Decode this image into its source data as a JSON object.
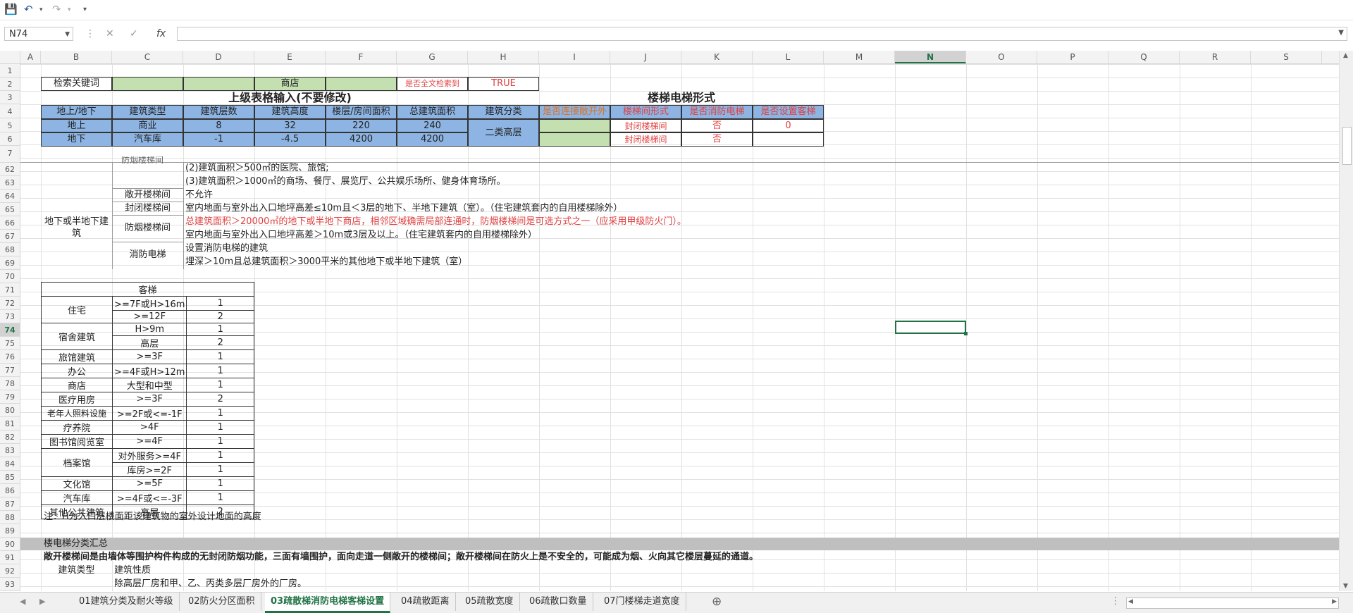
{
  "formula_bar": {
    "name_box": "N74",
    "fx_label": "fx",
    "formula": ""
  },
  "columns": [
    "A",
    "B",
    "C",
    "D",
    "E",
    "F",
    "G",
    "H",
    "I",
    "J",
    "K",
    "L",
    "M",
    "N",
    "O",
    "P",
    "Q",
    "R",
    "S"
  ],
  "selected_column": "N",
  "rows": [
    "1",
    "2",
    "3",
    "4",
    "5",
    "6",
    "7",
    "62",
    "63",
    "64",
    "65",
    "66",
    "67",
    "68",
    "69",
    "70",
    "71",
    "72",
    "73",
    "74",
    "75",
    "76",
    "77",
    "78",
    "79",
    "80",
    "81",
    "82",
    "83",
    "84",
    "85",
    "86",
    "87",
    "88",
    "89",
    "90",
    "91",
    "92",
    "93"
  ],
  "top": {
    "search_label": "检索关键词",
    "search_value": "商店",
    "fulltext_label": "是否全文检索到",
    "fulltext_value": "TRUE",
    "section_left": "上级表格输入(不要修改)",
    "section_right": "楼梯电梯形式",
    "headers": [
      "地上/地下",
      "建筑类型",
      "建筑层数",
      "建筑高度",
      "楼层/房间面积",
      "总建筑面积",
      "建筑分类",
      "是否连接敞开外",
      "楼梯间形式",
      "是否消防电梯",
      "是否设置客梯"
    ],
    "row_above": [
      "地上",
      "商业",
      "8",
      "32",
      "220",
      "240"
    ],
    "row_below": [
      "地下",
      "汽车库",
      "-1",
      "-4.5",
      "4200",
      "4200"
    ],
    "classification": "二类高层",
    "stair_above": "封闭楼梯间",
    "stair_below": "封闭楼梯间",
    "fire_elev_above": "否",
    "fire_elev_below": "否",
    "passenger": "0"
  },
  "rules": {
    "cut_label": "防烟楼梯间",
    "row62": "(2)建筑面积＞500㎡的医院、旅馆;",
    "row63": "(3)建筑面积＞1000㎡的商场、餐厅、展览厅、公共娱乐场所、健身体育场所。",
    "group_label": "地下或半地下建筑",
    "open_label": "敞开楼梯间",
    "open_text": "不允许",
    "closed_label": "封闭楼梯间",
    "closed_text": "室内地面与室外出入口地坪高差≤10m且＜3层的地下、半地下建筑（室）。（住宅建筑套内的自用楼梯除外）",
    "smoke_label": "防烟楼梯间",
    "smoke_text1": "总建筑面积＞20000㎡的地下或半地下商店，相邻区域确需局部连通时，防烟楼梯间是可选方式之一（应采用甲级防火门）。",
    "smoke_text2": "室内地面与室外出入口地坪高差＞10m或3层及以上。（住宅建筑套内的自用楼梯除外）",
    "elev_label": "消防电梯",
    "elev_text1": "设置消防电梯的建筑",
    "elev_text2": "埋深＞10m且总建筑面积＞3000平米的其他地下或半地下建筑（室）"
  },
  "elevator_table": {
    "title": "客梯",
    "rows": [
      {
        "type": "住宅",
        "cond": ">=7F或H>16m",
        "n": "1"
      },
      {
        "type": "",
        "cond": ">=12F",
        "n": "2"
      },
      {
        "type": "宿舍建筑",
        "cond": "H>9m",
        "n": "1"
      },
      {
        "type": "",
        "cond": "高层",
        "n": "2"
      },
      {
        "type": "旅馆建筑",
        "cond": ">=3F",
        "n": "1"
      },
      {
        "type": "办公",
        "cond": ">=4F或H>12m",
        "n": "1"
      },
      {
        "type": "商店",
        "cond": "大型和中型",
        "n": "1"
      },
      {
        "type": "医疗用房",
        "cond": ">=3F",
        "n": "2"
      },
      {
        "type": "老年人照料设施",
        "cond": ">=2F或<=-1F",
        "n": "1"
      },
      {
        "type": "疗养院",
        "cond": ">4F",
        "n": "1"
      },
      {
        "type": "图书馆阅览室",
        "cond": ">=4F",
        "n": "1"
      },
      {
        "type": "档案馆",
        "cond": "对外服务>=4F",
        "n": "1"
      },
      {
        "type": "",
        "cond": "库房>=2F",
        "n": "1"
      },
      {
        "type": "文化馆",
        "cond": ">=5F",
        "n": "1"
      },
      {
        "type": "汽车库",
        "cond": ">=4F或<=-3F",
        "n": "1"
      },
      {
        "type": "其他公共建筑",
        "cond": "高层",
        "n": "2"
      }
    ]
  },
  "notes": {
    "note": "注：H为入口层楼面距该建筑物的室外设计地面的高度",
    "summary_title": "楼电梯分类汇总",
    "open_def": "敞开楼梯间是由墙体等围护构件构成的无封闭防烟功能，三面有墙围护，面向走道一侧敞开的楼梯间；敞开楼梯间在防火上是不安全的，可能成为烟、火向其它楼层蔓延的通道。",
    "row92_b": "建筑类型",
    "row92_c": "建筑性质",
    "row93_c": "除高层厂房和甲、乙、丙类多层厂房外的厂房。"
  },
  "sheet_tabs": [
    "01建筑分类及耐火等级",
    "02防火分区面积",
    "03疏散梯消防电梯客梯设置",
    "04疏散距离",
    "05疏散宽度",
    "06疏散口数量",
    "07门楼梯走道宽度"
  ],
  "active_tab": "03疏散梯消防电梯客梯设置"
}
